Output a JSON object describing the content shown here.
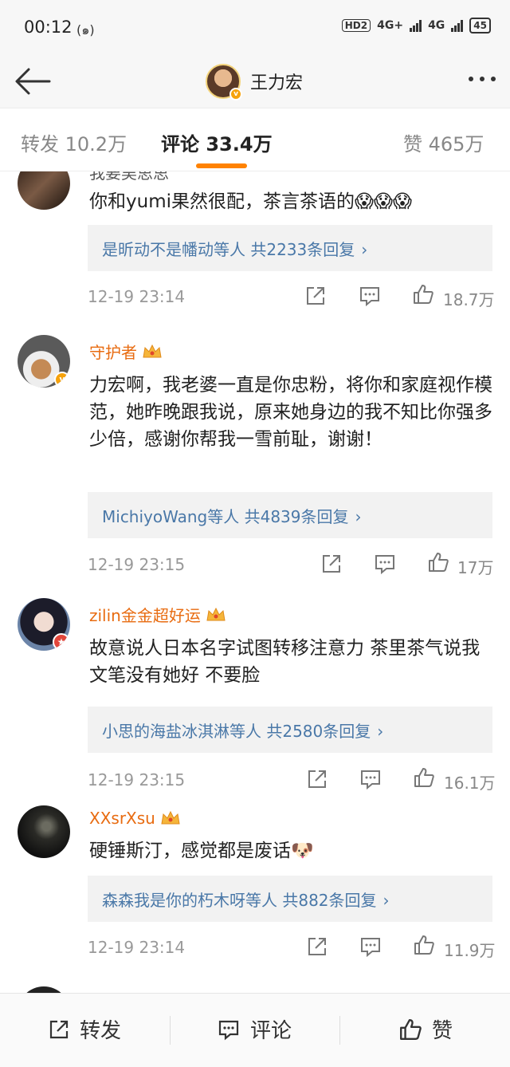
{
  "status_bar": {
    "time": "00:12",
    "signal_left": "(๑)",
    "hd": "HD2",
    "net1": "4G+",
    "net2": "4G",
    "battery": "45"
  },
  "nav": {
    "title": "王力宏"
  },
  "tabs": [
    {
      "label": "转发 10.2万"
    },
    {
      "label": "评论 33.4万"
    },
    {
      "label": "赞 465万"
    }
  ],
  "comments": [
    {
      "name": "我要吴思思",
      "text": "你和yumi果然很配，茶言茶语的😱😱😱",
      "reply": "是昕动不是幡动等人  共2233条回复",
      "time": "12-19 23:14",
      "likes": "18.7万"
    },
    {
      "name": "守护者",
      "text": "力宏啊，我老婆一直是你忠粉，将你和家庭视作模范，她昨晚跟我说，原来她身边的我不知比你强多少倍，感谢你帮我一雪前耻，谢谢！",
      "reply": "MichiyoWang等人  共4839条回复",
      "time": "12-19 23:15",
      "likes": "17万"
    },
    {
      "name": "zilin金金超好运",
      "text": "故意说人日本名字试图转移注意力 茶里茶气说我文笔没有她好 不要脸",
      "reply": "小思的海盐冰淇淋等人  共2580条回复",
      "time": "12-19 23:15",
      "likes": "16.1万"
    },
    {
      "name": "XXsrXsu",
      "text": "硬锤斯汀，感觉都是废话🐶",
      "reply": "森森我是你的朽木呀等人  共882条回复",
      "time": "12-19 23:14",
      "likes": "11.9万"
    }
  ],
  "bottom_bar": {
    "repost": "转发",
    "comment": "评论",
    "like": "赞"
  },
  "colors": {
    "accent": "#ff8200",
    "link": "#4a78a8",
    "username": "#e86b10"
  }
}
